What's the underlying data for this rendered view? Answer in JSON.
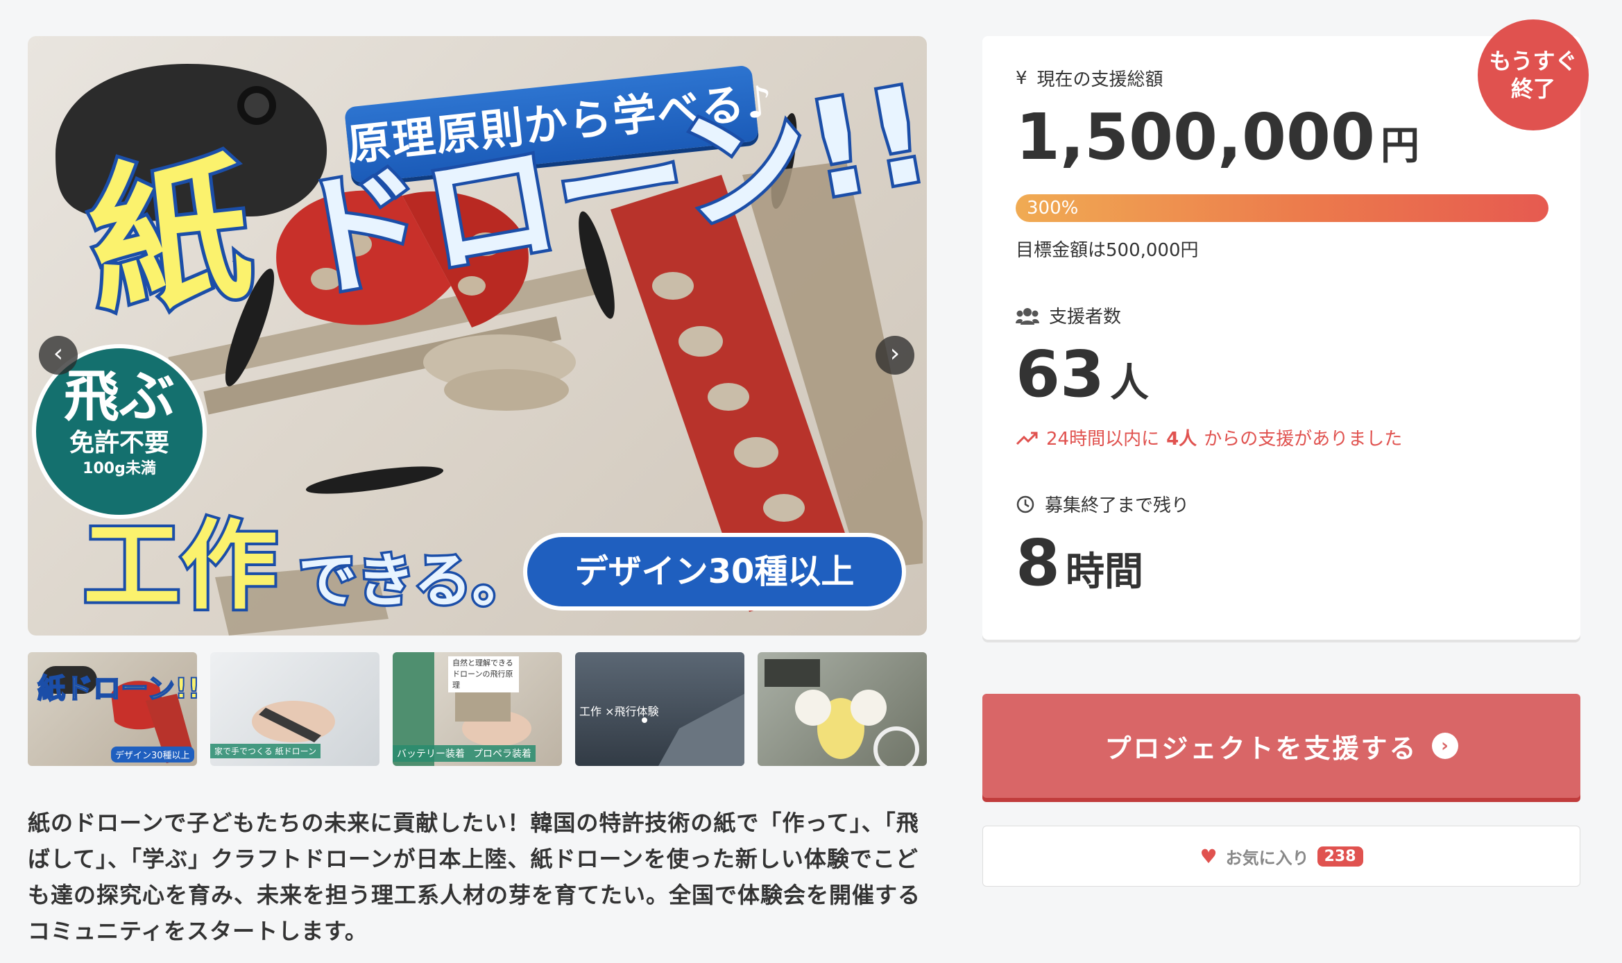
{
  "hero": {
    "banner_top": "原理原則から学べる♪",
    "title_kami": "紙",
    "title_drone": "ドローン!!",
    "badge_line1": "飛ぶ",
    "badge_line2": "免許不要",
    "badge_line3": "100g未満",
    "title_kousaku": "工作",
    "title_dekiru": "できる。",
    "design_pill": "デザイン30種以上",
    "prev_icon": "‹",
    "next_icon": "›"
  },
  "thumbnails": [
    {
      "caption": "デザイン30種以上",
      "mini": "紙ドローン!!"
    },
    {
      "caption": "家で手でつくる 紙ドローン"
    },
    {
      "caption": "バッテリー装着",
      "caption2": "プロペラ装着",
      "top": "自然と理解できる ドローンの飛行原理"
    },
    {
      "caption": "工作 ×飛行体験"
    },
    {
      "caption": ""
    }
  ],
  "description": "紙のドローンで子どもたちの未来に貢献したい！韓国の特許技術の紙で「作って」、「飛ばして」、「学ぶ」クラフトドローンが日本上陸、紙ドローンを使った新しい体験でこども達の探究心を育み、未来を担う理工系人材の芽を育てたい。全国で体験会を開催するコミュニティをスタートします。",
  "panel": {
    "ending_badge_line1": "もうすぐ",
    "ending_badge_line2": "終了",
    "total_label": "現在の支援総額",
    "total_icon": "¥",
    "total_value": "1,500,000",
    "total_unit": "円",
    "progress_percent": 300,
    "progress_label": "300%",
    "goal_text": "目標金額は500,000円",
    "supporters_label": "支援者数",
    "supporters_value": "63",
    "supporters_unit": "人",
    "recent_prefix": "24時間以内に",
    "recent_count": "4人",
    "recent_suffix": "からの支援がありました",
    "remaining_label": "募集終了まで残り",
    "remaining_value": "8",
    "remaining_unit": "時間"
  },
  "actions": {
    "support_label": "プロジェクトを支援する",
    "support_arrow": "›",
    "favorite_label": "お気に入り",
    "favorite_count": "238"
  },
  "colors": {
    "accent": "#e0524f",
    "support_button": "#d96667",
    "progress_start": "#f0ab53",
    "progress_end": "#e65a50"
  }
}
